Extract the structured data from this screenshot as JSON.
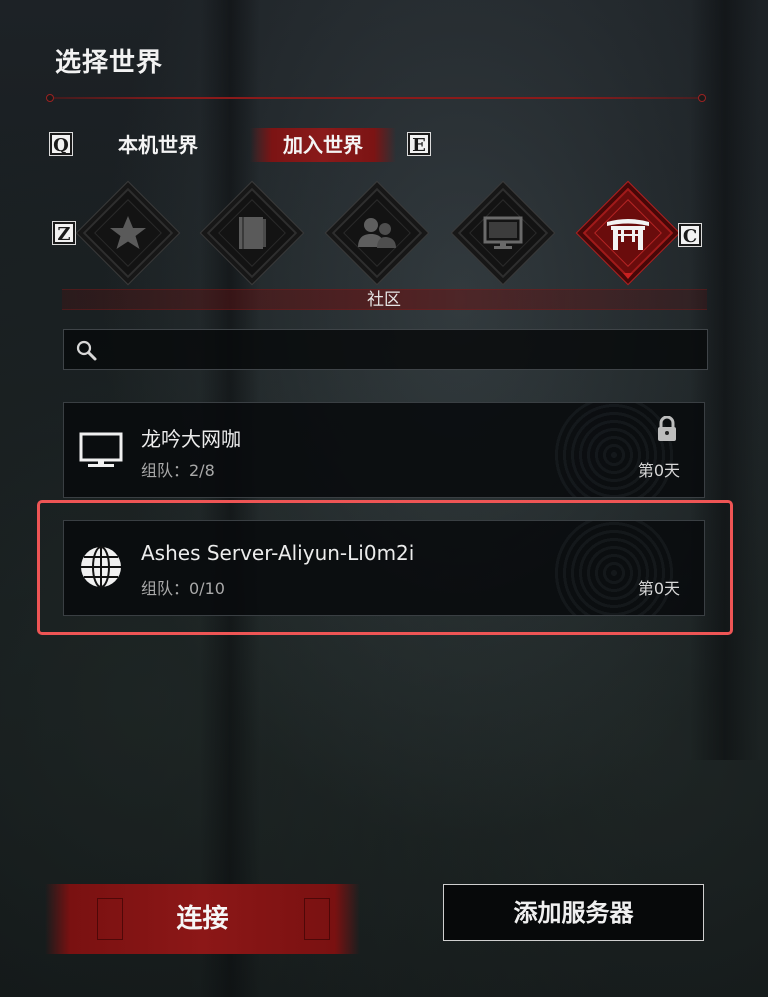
{
  "title": "选择世界",
  "tabs": {
    "prev_key": "Q",
    "next_key": "E",
    "items": [
      {
        "label": "本机世界",
        "active": false
      },
      {
        "label": "加入世界",
        "active": true
      }
    ]
  },
  "categories": {
    "prev_key": "Z",
    "next_key": "C",
    "items": [
      {
        "icon": "star-icon",
        "active": false
      },
      {
        "icon": "book-icon",
        "active": false
      },
      {
        "icon": "friends-icon",
        "active": false
      },
      {
        "icon": "monitor-icon",
        "active": false
      },
      {
        "icon": "gate-icon",
        "active": true
      }
    ],
    "selected_label": "社区"
  },
  "search": {
    "icon": "search-icon",
    "value": "",
    "placeholder": ""
  },
  "servers": [
    {
      "icon": "monitor-icon",
      "name": "龙吟大网咖",
      "team": "组队：2/8",
      "day": "第0天",
      "locked": true
    },
    {
      "icon": "globe-icon",
      "name": "Ashes Server-Aliyun-Li0m2i",
      "team": "组队：0/10",
      "day": "第0天",
      "locked": false,
      "highlighted": true
    }
  ],
  "buttons": {
    "connect": "连接",
    "add_server": "添加服务器"
  },
  "colors": {
    "accent_red": "#8a1a1a",
    "highlight": "#ee5555"
  }
}
